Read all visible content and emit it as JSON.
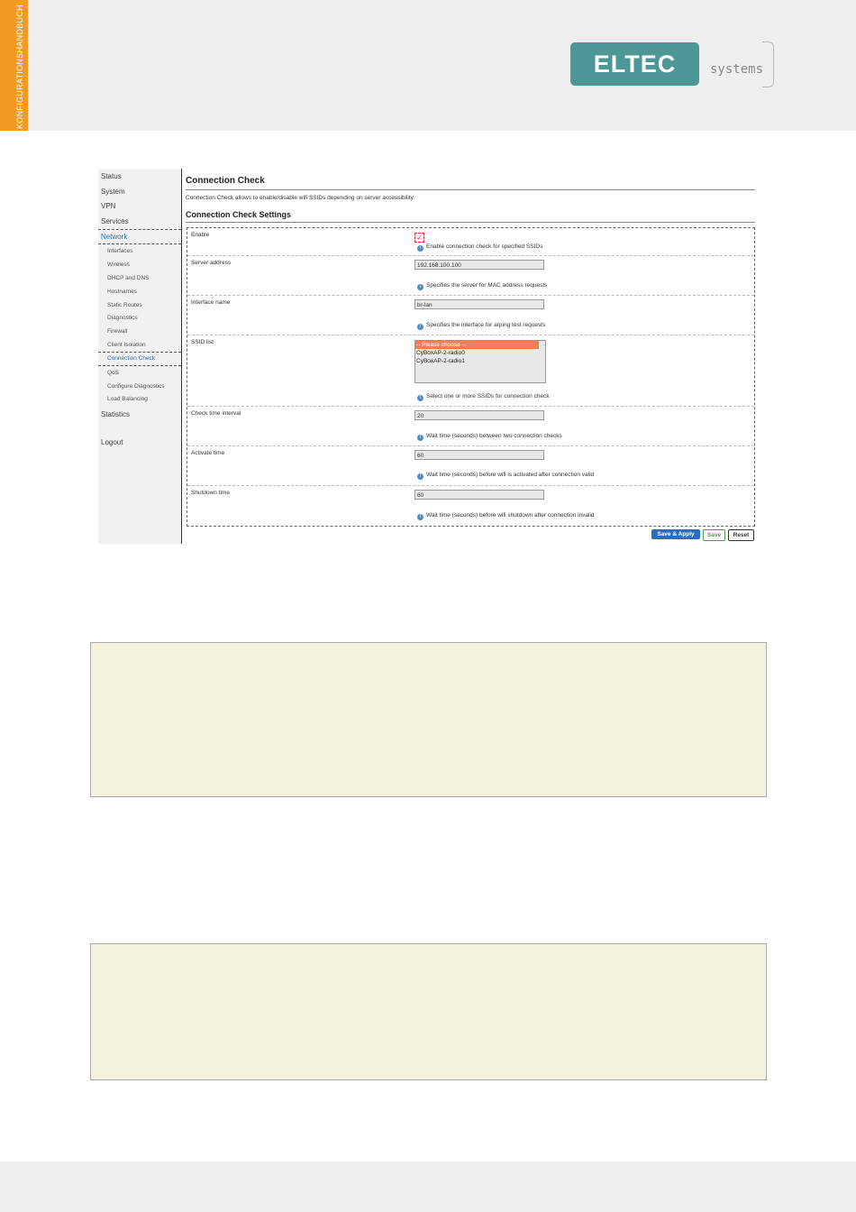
{
  "header": {
    "side_tab": "KONFIGURATIONSHANDBUCH",
    "logo_text": "ELTEC",
    "logo_sub": "systems"
  },
  "nav": {
    "items": [
      {
        "label": "Status"
      },
      {
        "label": "System"
      },
      {
        "label": "VPN"
      },
      {
        "label": "Services"
      },
      {
        "label": "Network"
      },
      {
        "label": "Interfaces"
      },
      {
        "label": "Wireless"
      },
      {
        "label": "DHCP and DNS"
      },
      {
        "label": "Hostnames"
      },
      {
        "label": "Static Routes"
      },
      {
        "label": "Diagnostics"
      },
      {
        "label": "Firewall"
      },
      {
        "label": "Client Isolation"
      },
      {
        "label": "Connection Check"
      },
      {
        "label": "QoS"
      },
      {
        "label": "Configure Diagnostics"
      },
      {
        "label": "Load Balancing"
      },
      {
        "label": "Statistics"
      },
      {
        "label": "Logout"
      }
    ]
  },
  "page": {
    "title": "Connection Check",
    "description": "Connection Check allows to enable/disable wifi SSIDs depending on server accessibility",
    "section_title": "Connection Check Settings"
  },
  "form": {
    "enable": {
      "label": "Enable",
      "hint": "Enable connection check for specified SSIDs",
      "checked": true
    },
    "server": {
      "label": "Server address",
      "value": "192.168.100.100",
      "hint": "Specifies the server for MAC address requests"
    },
    "interface": {
      "label": "Interface name",
      "value": "br-lan",
      "hint": "Specifies the interface for arping test requests"
    },
    "ssid": {
      "label": "SSID list",
      "options": [
        "-- Please choose --",
        "CyBoxAP-2-radio0",
        "CyBoxAP-2-radio1"
      ],
      "hint": "Select one or more SSIDs for connection check"
    },
    "interval": {
      "label": "Check time interval",
      "value": "20",
      "hint": "Wait time (seconds) between two connection checks"
    },
    "activate": {
      "label": "Activate time",
      "value": "60",
      "hint": "Wait time (seconds) before wifi is activated after connection valid"
    },
    "shutdown": {
      "label": "Shutdown time",
      "value": "60",
      "hint": "Wait time (seconds) before wifi shutdown after connection invalid"
    }
  },
  "buttons": {
    "save_apply": "Save & Apply",
    "save": "Save",
    "reset": "Reset"
  },
  "colors": {
    "side_tab": "#f29a22",
    "logo": "#4d9797",
    "note_bg": "#f4f2dd",
    "primary_button": "#2a6dbd"
  }
}
